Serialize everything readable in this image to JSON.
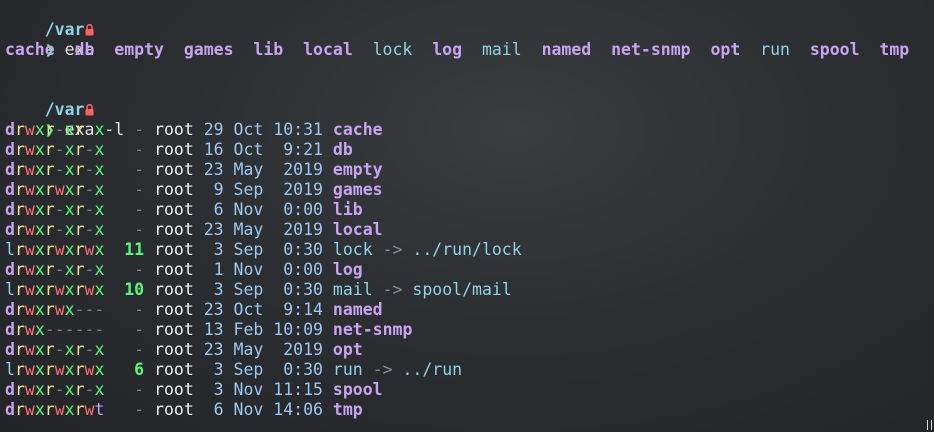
{
  "block1": {
    "cwd": "/var",
    "lock_icon": "lock-icon",
    "prompt_symbol": "❯",
    "command": "exa",
    "entries": [
      {
        "name": "cache",
        "kind": "dir"
      },
      {
        "name": "db",
        "kind": "dir"
      },
      {
        "name": "empty",
        "kind": "dir"
      },
      {
        "name": "games",
        "kind": "dir"
      },
      {
        "name": "lib",
        "kind": "dir"
      },
      {
        "name": "local",
        "kind": "dir"
      },
      {
        "name": "lock",
        "kind": "link"
      },
      {
        "name": "log",
        "kind": "dir"
      },
      {
        "name": "mail",
        "kind": "link"
      },
      {
        "name": "named",
        "kind": "dir"
      },
      {
        "name": "net-snmp",
        "kind": "dir"
      },
      {
        "name": "opt",
        "kind": "dir"
      },
      {
        "name": "run",
        "kind": "link"
      },
      {
        "name": "spool",
        "kind": "dir"
      },
      {
        "name": "tmp",
        "kind": "dir"
      }
    ]
  },
  "block2": {
    "cwd": "/var",
    "prompt_symbol": "❯",
    "command": "exa -l",
    "rows": [
      {
        "perms": "drwxr-xr-x",
        "size": "-",
        "user": "root",
        "date": "29 Oct 10:31",
        "name": "cache",
        "kind": "dir",
        "target": ""
      },
      {
        "perms": "drwxr-xr-x",
        "size": "-",
        "user": "root",
        "date": "16 Oct  9:21",
        "name": "db",
        "kind": "dir",
        "target": ""
      },
      {
        "perms": "drwxr-xr-x",
        "size": "-",
        "user": "root",
        "date": "23 May  2019",
        "name": "empty",
        "kind": "dir",
        "target": ""
      },
      {
        "perms": "drwxrwxr-x",
        "size": "-",
        "user": "root",
        "date": " 9 Sep  2019",
        "name": "games",
        "kind": "dir",
        "target": ""
      },
      {
        "perms": "drwxr-xr-x",
        "size": "-",
        "user": "root",
        "date": " 6 Nov  0:00",
        "name": "lib",
        "kind": "dir",
        "target": ""
      },
      {
        "perms": "drwxr-xr-x",
        "size": "-",
        "user": "root",
        "date": "23 May  2019",
        "name": "local",
        "kind": "dir",
        "target": ""
      },
      {
        "perms": "lrwxrwxrwx",
        "size": "11",
        "user": "root",
        "date": " 3 Sep  0:30",
        "name": "lock",
        "kind": "link",
        "target": "../run/lock"
      },
      {
        "perms": "drwxr-xr-x",
        "size": "-",
        "user": "root",
        "date": " 1 Nov  0:00",
        "name": "log",
        "kind": "dir",
        "target": ""
      },
      {
        "perms": "lrwxrwxrwx",
        "size": "10",
        "user": "root",
        "date": " 3 Sep  0:30",
        "name": "mail",
        "kind": "link",
        "target": "spool/mail"
      },
      {
        "perms": "drwxrwx---",
        "size": "-",
        "user": "root",
        "date": "23 Oct  9:14",
        "name": "named",
        "kind": "dir",
        "target": ""
      },
      {
        "perms": "drwx------",
        "size": "-",
        "user": "root",
        "date": "13 Feb 10:09",
        "name": "net-snmp",
        "kind": "dir",
        "target": ""
      },
      {
        "perms": "drwxr-xr-x",
        "size": "-",
        "user": "root",
        "date": "23 May  2019",
        "name": "opt",
        "kind": "dir",
        "target": ""
      },
      {
        "perms": "lrwxrwxrwx",
        "size": "6",
        "user": "root",
        "date": " 3 Sep  0:30",
        "name": "run",
        "kind": "link",
        "target": "../run"
      },
      {
        "perms": "drwxr-xr-x",
        "size": "-",
        "user": "root",
        "date": " 3 Nov 11:15",
        "name": "spool",
        "kind": "dir",
        "target": ""
      },
      {
        "perms": "drwxrwxrwt",
        "size": "-",
        "user": "root",
        "date": " 6 Nov 14:06",
        "name": "tmp",
        "kind": "dir",
        "target": ""
      }
    ]
  },
  "colors": {
    "dir": "#c8a4f0",
    "link": "#8fd3e8",
    "perm_read": "#f1e38c",
    "perm_write": "#ff6e6e",
    "perm_exec": "#50fa7b",
    "prompt": "#50fa7b",
    "lock": "#ff5f5f"
  }
}
